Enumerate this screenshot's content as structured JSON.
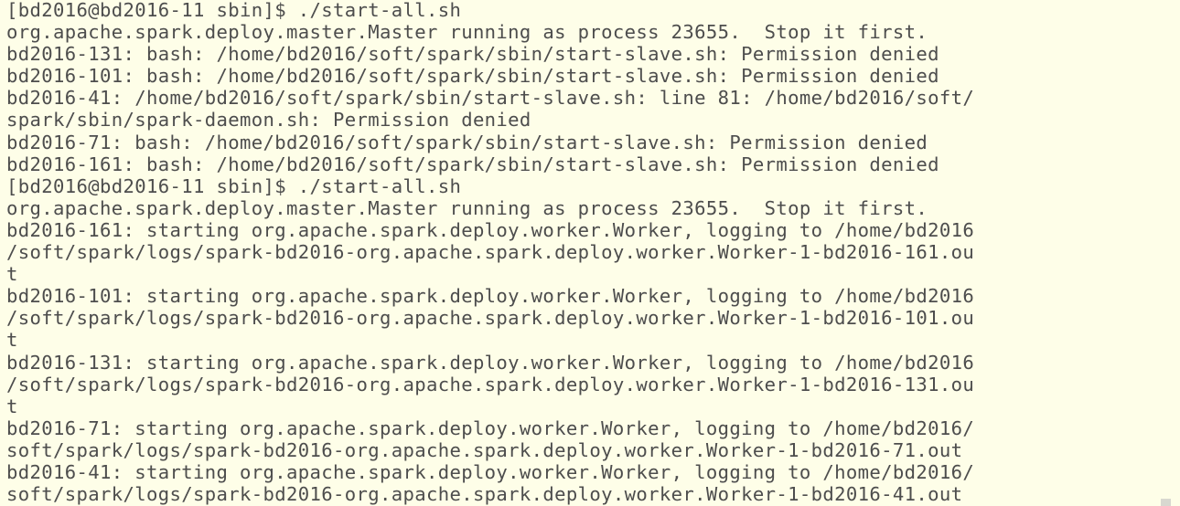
{
  "terminal": {
    "lines": [
      "[bd2016@bd2016-11 sbin]$ ./start-all.sh",
      "org.apache.spark.deploy.master.Master running as process 23655.  Stop it first.",
      "bd2016-131: bash: /home/bd2016/soft/spark/sbin/start-slave.sh: Permission denied",
      "bd2016-101: bash: /home/bd2016/soft/spark/sbin/start-slave.sh: Permission denied",
      "bd2016-41: /home/bd2016/soft/spark/sbin/start-slave.sh: line 81: /home/bd2016/soft/",
      "spark/sbin/spark-daemon.sh: Permission denied",
      "bd2016-71: bash: /home/bd2016/soft/spark/sbin/start-slave.sh: Permission denied",
      "bd2016-161: bash: /home/bd2016/soft/spark/sbin/start-slave.sh: Permission denied",
      "[bd2016@bd2016-11 sbin]$ ./start-all.sh",
      "org.apache.spark.deploy.master.Master running as process 23655.  Stop it first.",
      "bd2016-161: starting org.apache.spark.deploy.worker.Worker, logging to /home/bd2016",
      "/soft/spark/logs/spark-bd2016-org.apache.spark.deploy.worker.Worker-1-bd2016-161.ou",
      "t",
      "bd2016-101: starting org.apache.spark.deploy.worker.Worker, logging to /home/bd2016",
      "/soft/spark/logs/spark-bd2016-org.apache.spark.deploy.worker.Worker-1-bd2016-101.ou",
      "t",
      "bd2016-131: starting org.apache.spark.deploy.worker.Worker, logging to /home/bd2016",
      "/soft/spark/logs/spark-bd2016-org.apache.spark.deploy.worker.Worker-1-bd2016-131.ou",
      "t",
      "bd2016-71: starting org.apache.spark.deploy.worker.Worker, logging to /home/bd2016/",
      "soft/spark/logs/spark-bd2016-org.apache.spark.deploy.worker.Worker-1-bd2016-71.out",
      "bd2016-41: starting org.apache.spark.deploy.worker.Worker, logging to /home/bd2016/",
      "soft/spark/logs/spark-bd2016-org.apache.spark.deploy.worker.Worker-1-bd2016-41.out"
    ]
  },
  "colors": {
    "background": "#fefee8",
    "text": "#4d4d4d"
  }
}
